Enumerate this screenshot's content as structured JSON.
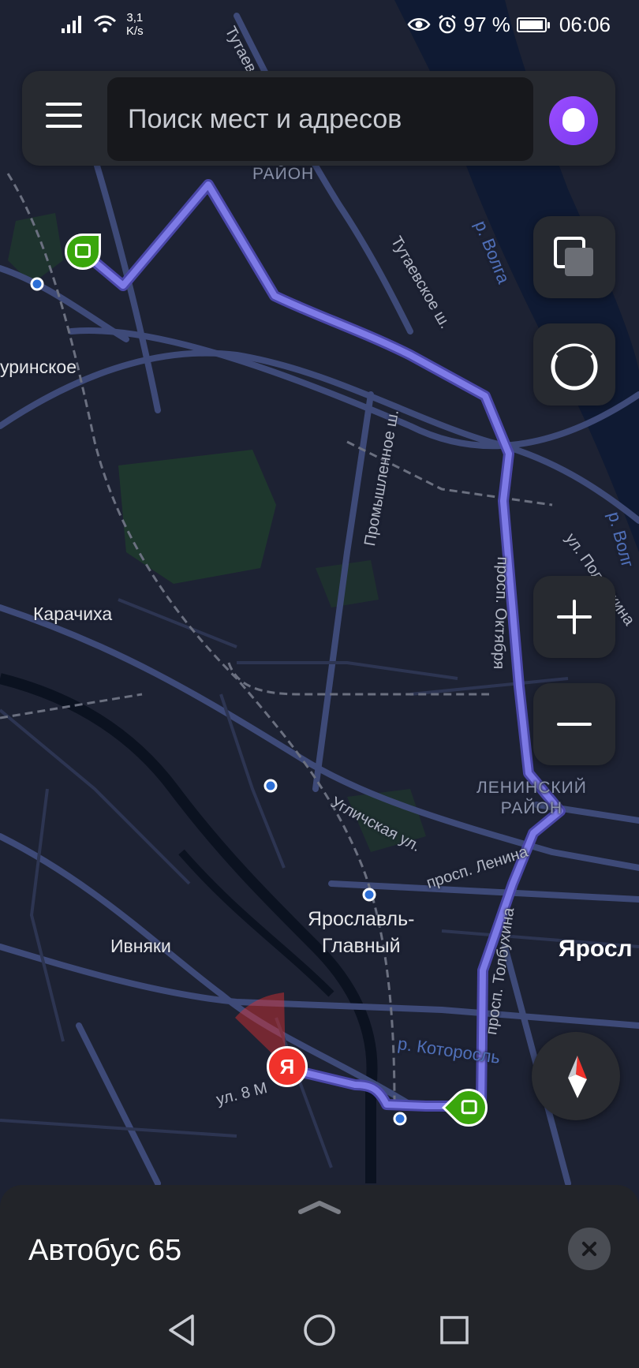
{
  "status_bar": {
    "network_speed_value": "3,1",
    "network_speed_unit": "K/s",
    "battery": "97 %",
    "battery_level": 0.97,
    "time": "06:06"
  },
  "search": {
    "placeholder": "Поиск мест и адресов"
  },
  "map": {
    "labels": {
      "district_top": "РАЙОН",
      "place_urinskoe": "уринское",
      "place_karachikha": "Карачиха",
      "place_ivnyaki": "Ивняки",
      "station": "Ярославль-\nГлавный",
      "city": "Яросл",
      "district_leninsky": "ЛЕНИНСКИЙ\nРАЙОН",
      "street_tutaevskoe_top": "Тутаевское ш.",
      "street_tutaevskoe": "Тутаевское ш.",
      "street_promyshlennoe": "Промышленное ш.",
      "street_oktyabrya": "просп. Октября",
      "street_uglichskaya": "Угличская ул.",
      "street_lenina": "просп. Ленина",
      "street_tolbukhina": "просп. Толбухина",
      "street_polushkina": "ул. Полушкина",
      "street_8m": "ул. 8 М",
      "river_volga": "р. Волга",
      "river_volga_2": "р. Волг",
      "river_kotorosl": "р. Которосль"
    },
    "route_color": "#6f6cd8",
    "stop_color": "#3aa60c",
    "marker_color": "#f0322b",
    "user_marker_letter": "Я"
  },
  "sheet": {
    "title": "Автобус 65"
  },
  "icons": {
    "menu": "hamburger-icon",
    "alice": "alice-icon",
    "layers": "layers-icon",
    "alice_circle": "alice-circle-icon",
    "zoom_in": "plus-icon",
    "zoom_out": "minus-icon",
    "compass": "compass-icon",
    "bus_stop": "bus-icon",
    "close": "close-icon"
  }
}
